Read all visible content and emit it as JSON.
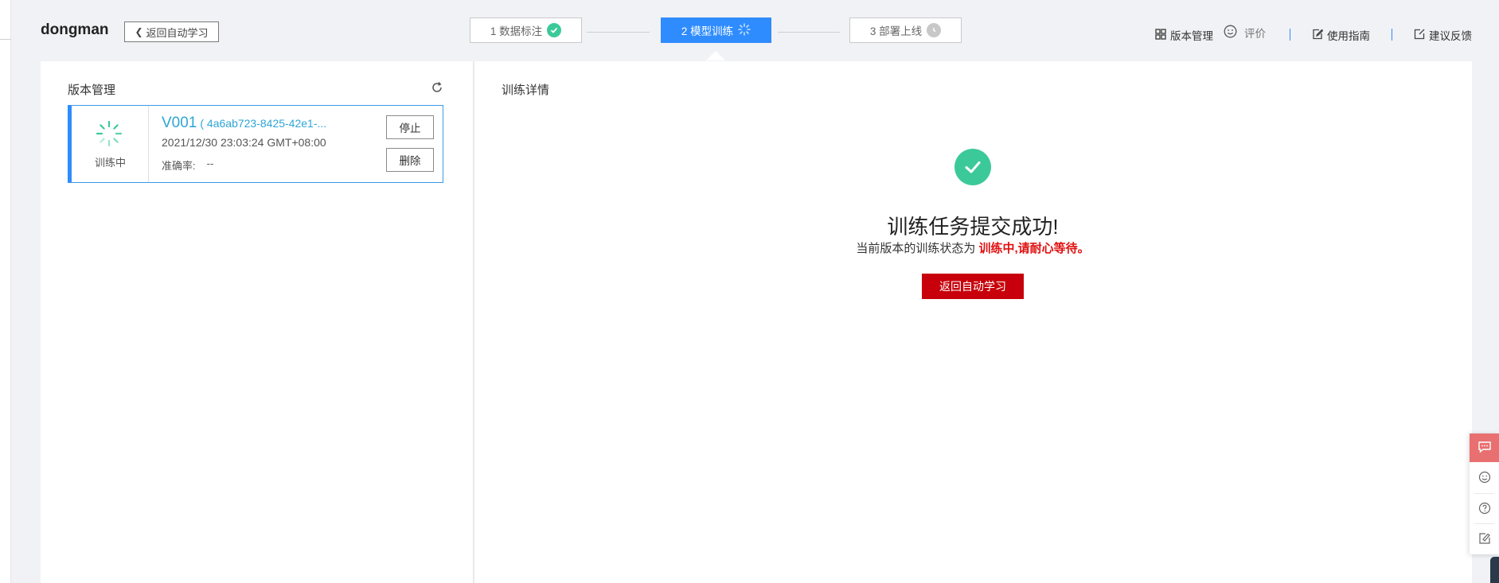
{
  "app": {
    "name": "dongman",
    "back_label": "返回自动学习"
  },
  "steps": [
    {
      "label": "1 数据标注",
      "state": "done"
    },
    {
      "label": "2 模型训练",
      "state": "active"
    },
    {
      "label": "3 部署上线",
      "state": "pending"
    }
  ],
  "top_links": {
    "version_mgmt": "版本管理",
    "rating": "评价",
    "guide": "使用指南",
    "feedback": "建议反馈"
  },
  "left_panel": {
    "title": "版本管理",
    "card": {
      "status": "训练中",
      "version": "V001",
      "uid": "( 4a6ab723-8425-42e1-...",
      "date": "2021/12/30 23:03:24 GMT+08:00",
      "acc_label": "准确率:",
      "acc_value": "--",
      "stop_label": "停止",
      "delete_label": "删除"
    }
  },
  "right_panel": {
    "title": "训练详情",
    "success_title": "训练任务提交成功!",
    "desc_prefix": "当前版本的训练状态为",
    "desc_highlight": "训练中,请耐心等待。",
    "return_label": "返回自动学习"
  },
  "colors": {
    "accent_blue": "#2f8cff",
    "success_green": "#3cc99a",
    "primary_red": "#c7000b",
    "highlight_red": "#e01010"
  }
}
